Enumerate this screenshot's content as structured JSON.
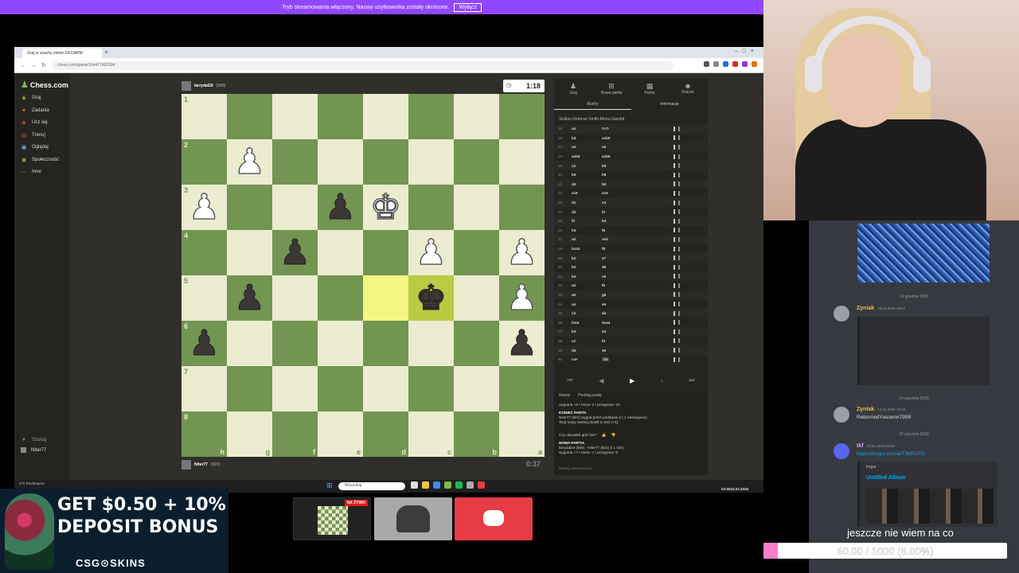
{
  "stream_banner": {
    "text": "Tryb streamowania włączony. Nazwy użytkownika zostały skrócone.",
    "button": "Wyłącz"
  },
  "browser": {
    "tab_title": "Graj w szachy online ZA DARM",
    "url": "chess.com/game/164477462594"
  },
  "chess": {
    "logo": "Chess.com",
    "sidebar": [
      {
        "icon": "play-icon",
        "glyph": "♟",
        "label": "Graj"
      },
      {
        "icon": "puzzle-icon",
        "glyph": "✦",
        "label": "Zadania"
      },
      {
        "icon": "learn-icon",
        "glyph": "◈",
        "label": "Ucz się"
      },
      {
        "icon": "train-icon",
        "glyph": "◎",
        "label": "Trenuj"
      },
      {
        "icon": "watch-icon",
        "glyph": "▣",
        "label": "Oglądaj"
      },
      {
        "icon": "community-icon",
        "glyph": "◉",
        "label": "Społeczność"
      },
      {
        "icon": "more-icon",
        "glyph": "⋯",
        "label": "Inne"
      }
    ],
    "sidebar_bottom": {
      "search": "Szukaj",
      "user": "Niter77"
    },
    "top_player": {
      "name": "larrydal24",
      "rating": "(566)",
      "clock": "1:18"
    },
    "bottom_player": {
      "name": "Niter77",
      "rating": "(622)",
      "clock": "0:37"
    },
    "ranks": [
      "1",
      "2",
      "3",
      "4",
      "5",
      "6",
      "7",
      "8"
    ],
    "files": [
      "h",
      "g",
      "f",
      "e",
      "d",
      "c",
      "b",
      "a"
    ],
    "pieces": [
      {
        "sq": "g2",
        "piece": "♟",
        "color": "white"
      },
      {
        "sq": "h3",
        "piece": "♟",
        "color": "white"
      },
      {
        "sq": "e3",
        "piece": "♟",
        "color": "black"
      },
      {
        "sq": "d3",
        "piece": "♚",
        "color": "white"
      },
      {
        "sq": "f4",
        "piece": "♟",
        "color": "black"
      },
      {
        "sq": "c4",
        "piece": "♟",
        "color": "white"
      },
      {
        "sq": "a4",
        "piece": "♟",
        "color": "white"
      },
      {
        "sq": "g5",
        "piece": "♟",
        "color": "black"
      },
      {
        "sq": "c5",
        "piece": "♚",
        "color": "black"
      },
      {
        "sq": "a5",
        "piece": "♟",
        "color": "white"
      },
      {
        "sq": "h6",
        "piece": "♟",
        "color": "black"
      },
      {
        "sq": "a6",
        "piece": "♟",
        "color": "black"
      }
    ],
    "highlight_squares": [
      "d5",
      "c5"
    ],
    "panel_tabs": [
      {
        "icon": "play-icon",
        "glyph": "♟",
        "label": "Graj"
      },
      {
        "icon": "new-game-icon",
        "glyph": "⊞",
        "label": "Nowa partia"
      },
      {
        "icon": "games-icon",
        "glyph": "▦",
        "label": "Partie"
      },
      {
        "icon": "players-icon",
        "glyph": "☻",
        "label": "Gracze"
      }
    ],
    "subtabs": [
      "Ruchy",
      "Informacje"
    ],
    "opening": "Sicilian Defense Smith-Morra Gambit",
    "moves": [
      {
        "n": "15.",
        "w": "a4",
        "b": "O-O"
      },
      {
        "n": "16.",
        "w": "b4",
        "b": "axb5"
      },
      {
        "n": "17.",
        "w": "a4",
        "b": "c6"
      },
      {
        "n": "18.",
        "w": "axb5",
        "b": "axb5"
      },
      {
        "n": "19.",
        "w": "c3",
        "b": "b5"
      },
      {
        "n": "20.",
        "w": "b3",
        "b": "h6"
      },
      {
        "n": "21.",
        "w": "d4",
        "b": "b6"
      },
      {
        "n": "22.",
        "w": "xc6",
        "b": "xc6"
      },
      {
        "n": "23.",
        "w": "d1",
        "b": "c4"
      },
      {
        "n": "24.",
        "w": "d3",
        "b": "f4"
      },
      {
        "n": "25.",
        "w": "f3",
        "b": "b4"
      },
      {
        "n": "26.",
        "w": "h3",
        "b": "f6"
      },
      {
        "n": "27.",
        "w": "a3",
        "b": "xe3"
      },
      {
        "n": "28.",
        "w": "bxa3",
        "b": "f8"
      },
      {
        "n": "29.",
        "w": "b2",
        "b": "e7"
      },
      {
        "n": "30.",
        "w": "b2",
        "b": "d6"
      },
      {
        "n": "31.",
        "w": "b4",
        "b": "c6"
      },
      {
        "n": "32.",
        "w": "a4",
        "b": "f5"
      },
      {
        "n": "33.",
        "w": "a5",
        "b": "g5"
      },
      {
        "n": "34.",
        "w": "a4",
        "b": "e5"
      },
      {
        "n": "35.",
        "w": "c3",
        "b": "d4"
      },
      {
        "n": "36.",
        "w": "fxe4",
        "b": "dxe4"
      },
      {
        "n": "37.",
        "w": "b3",
        "b": "e3"
      },
      {
        "n": "38.",
        "w": "c2",
        "b": "f4"
      },
      {
        "n": "39.",
        "w": "d3",
        "b": "e5"
      },
      {
        "n": "40.",
        "w": "c4+",
        "b": "c5"
      }
    ],
    "result": {
      "tools": [
        "Remis",
        "Poddaj partię"
      ],
      "summary1": "wygrana +9 / remis -2 / przegrana -10",
      "header1": "KONIEC PARTII",
      "line1": "Niter77 (622) wygrał przez poddanie (/ | 1 rankingowe)",
      "line2": "Twój nowy ranking Bullet to 622 (+6).",
      "ask": "Czy okazałeś grać fair?",
      "header2": "NOWA PARTIA",
      "line3": "larrydal24 (566) - Niter77 (622) (/ 1 min)",
      "summary2": "wygrana +7 / remis -1 / przegrana -9",
      "chat_placeholder": "Błyśnij wiadomością..."
    }
  },
  "taskbar": {
    "weather": "4°C Pochmurno",
    "search": "Wyszukaj",
    "time": "04:55",
    "date": "10.02.2026"
  },
  "discord": {
    "date1": "16 grudnia 2025",
    "msg1_name": "Zyniak",
    "msg1_time": "16.12.2025 18:52",
    "date2": "14 stycznia 2026",
    "msg2_name": "Zyniak",
    "msg2_time": "14.01.2026 18:15",
    "msg2_text": "RebornedYasoen#7999",
    "date3": "20 stycznia 2026",
    "msg3_name": "tkf",
    "msg3_time": "20.01.2026 03:40",
    "msg3_link": "https://imgur.com/a/T3kROTD",
    "embed_site": "Imgur",
    "embed_title": "Untitled Album"
  },
  "ad": {
    "line1": "GET $0.50 + 10%",
    "line2": "DEPOSIT BONUS",
    "brand": "CSG⊙SKINS"
  },
  "scenes": {
    "live_badge": "NA ŻYWO"
  },
  "goal": {
    "text": "jeszcze nie wiem na co",
    "label": "60.00 / 1000 (6.00%)",
    "progress": 0.06
  }
}
